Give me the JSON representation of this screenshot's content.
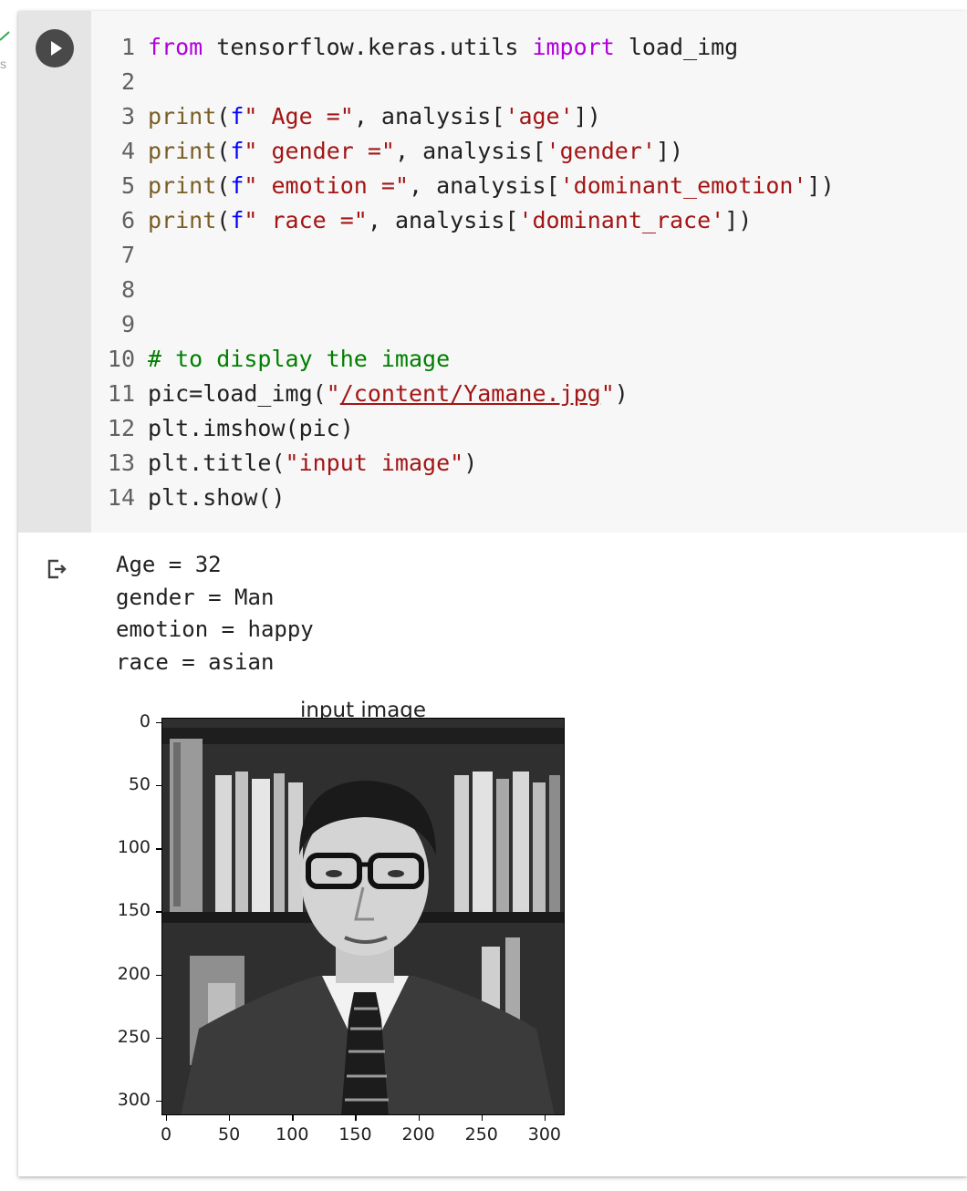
{
  "status": {
    "side_char": "s"
  },
  "cell": {
    "run_button": "run-cell-button",
    "code": {
      "l1": {
        "num": "1",
        "kw_from": "from",
        "module": " tensorflow.keras.utils ",
        "kw_import": "import",
        "name": " load_img"
      },
      "l2": {
        "num": "2"
      },
      "l3": {
        "num": "3",
        "fn": "print",
        "paren": "(",
        "f": "f",
        "str": "\" Age =\"",
        "mid": ", analysis[",
        "key": "'age'",
        "end": "])"
      },
      "l4": {
        "num": "4",
        "fn": "print",
        "paren": "(",
        "f": "f",
        "str": "\" gender =\"",
        "mid": ", analysis[",
        "key": "'gender'",
        "end": "])"
      },
      "l5": {
        "num": "5",
        "fn": "print",
        "paren": "(",
        "f": "f",
        "str": "\" emotion =\"",
        "mid": ", analysis[",
        "key": "'dominant_emotion'",
        "end": "])"
      },
      "l6": {
        "num": "6",
        "fn": "print",
        "paren": "(",
        "f": "f",
        "str": "\" race =\"",
        "mid": ", analysis[",
        "key": "'dominant_race'",
        "end": "])"
      },
      "l7": {
        "num": "7"
      },
      "l8": {
        "num": "8"
      },
      "l9": {
        "num": "9"
      },
      "l10": {
        "num": "10",
        "comment": "# to display the image"
      },
      "l11": {
        "num": "11",
        "pre": "pic=load_img(",
        "q1": "\"",
        "path": "/content/Yamane.jpg",
        "q2": "\"",
        "end": ")"
      },
      "l12": {
        "num": "12",
        "text": "plt.imshow(pic)"
      },
      "l13": {
        "num": "13",
        "pre": "plt.title(",
        "str": "\"input image\"",
        "end": ")"
      },
      "l14": {
        "num": "14",
        "text": "plt.show()"
      }
    }
  },
  "output": {
    "lines": [
      "Age = 32",
      "gender = Man",
      "emotion = happy",
      "race = asian"
    ],
    "plot": {
      "title": "input image",
      "yticks": [
        "0",
        "50",
        "100",
        "150",
        "200",
        "250",
        "300"
      ],
      "xticks": [
        "0",
        "50",
        "100",
        "150",
        "200",
        "250",
        "300"
      ],
      "image_description_icon": "portrait-photo-icon"
    }
  }
}
